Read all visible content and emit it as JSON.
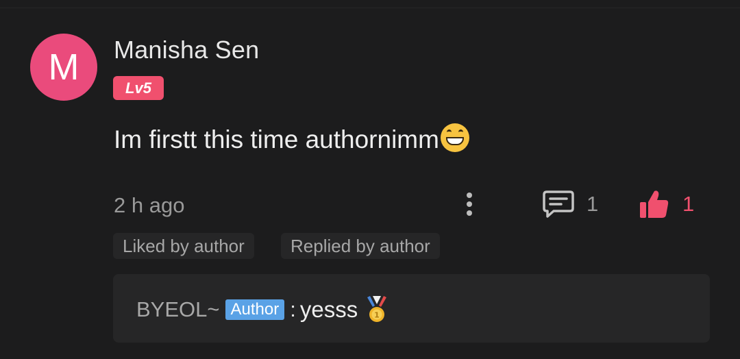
{
  "colors": {
    "background": "#1c1c1d",
    "avatar": "#ea4b7c",
    "level_badge": "#f0506e",
    "like_accent": "#f0506e",
    "author_badge": "#5aa2e6",
    "chip_background": "#262627"
  },
  "comment": {
    "avatar_letter": "M",
    "username": "Manisha Sen",
    "level": "Lv5",
    "text": "Im firstt this time authornimm",
    "emoji": "grinning-face-emoji",
    "timestamp": "2 h ago",
    "reply_count": "1",
    "like_count": "1",
    "tags": {
      "liked": "Liked by author",
      "replied": "Replied by author"
    }
  },
  "reply": {
    "author": "BYEOL~",
    "author_badge": "Author",
    "separator": ":",
    "text": "yesss",
    "emoji": "medal-icon"
  }
}
